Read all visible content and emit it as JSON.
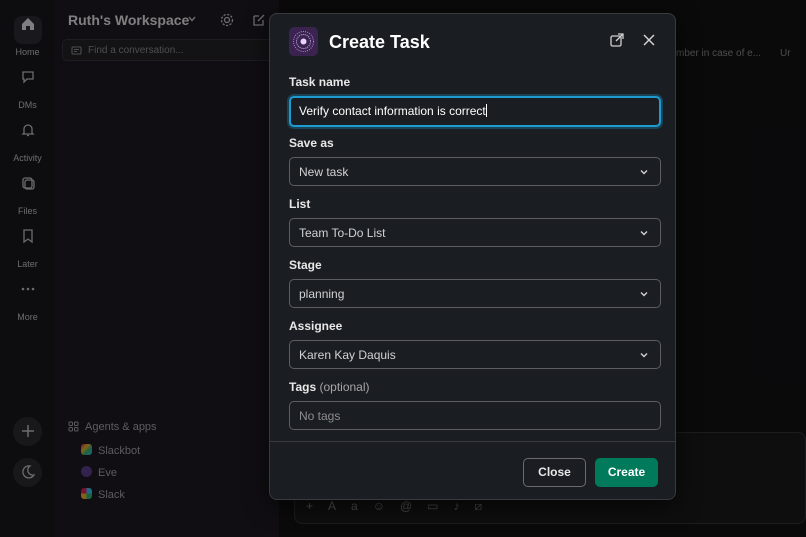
{
  "rail": {
    "items": [
      {
        "label": "Home"
      },
      {
        "label": "DMs"
      },
      {
        "label": "Activity"
      },
      {
        "label": "Files"
      },
      {
        "label": "Later"
      },
      {
        "label": "More"
      }
    ]
  },
  "sidebar": {
    "workspace_title": "Ruth's Workspace",
    "find_placeholder": "Find a conversation...",
    "agents_heading": "Agents & apps",
    "apps": [
      {
        "label": "Slackbot"
      },
      {
        "label": "Eve"
      },
      {
        "label": "Slack"
      }
    ]
  },
  "main": {
    "header_snippet": "mber in case of e...",
    "header_snippet2": "Ur"
  },
  "modal": {
    "title": "Create Task",
    "fields": {
      "task_name": {
        "label": "Task name",
        "value": "Verify contact information is correct"
      },
      "save_as": {
        "label": "Save as",
        "value": "New task"
      },
      "list": {
        "label": "List",
        "value": "Team To-Do List"
      },
      "stage": {
        "label": "Stage",
        "value": "planning"
      },
      "assignee": {
        "label": "Assignee",
        "value": "Karen Kay Daquis"
      },
      "tags": {
        "label": "Tags",
        "optional": "(optional)",
        "placeholder": "No tags"
      }
    },
    "buttons": {
      "close": "Close",
      "create": "Create"
    }
  },
  "colors": {
    "accent_focus": "#1d9bd1",
    "primary_button": "#007a5a"
  }
}
